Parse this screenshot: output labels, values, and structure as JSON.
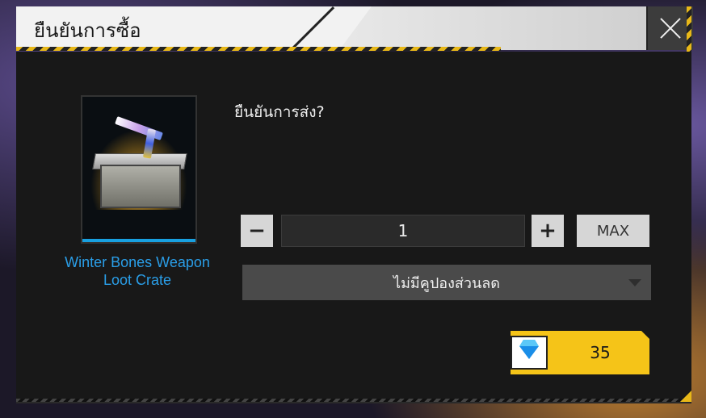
{
  "dialog": {
    "title": "ยืนยันการซื้อ",
    "question": "ยืนยันการส่ง?"
  },
  "item": {
    "name": "Winter Bones Weapon Loot Crate"
  },
  "quantity": {
    "minus_label": "−",
    "value": "1",
    "plus_label": "+",
    "max_label": "MAX"
  },
  "coupon": {
    "selected": "ไม่มีคูปองส่วนลด"
  },
  "purchase": {
    "currency_icon": "diamond-icon",
    "price": "35"
  },
  "colors": {
    "accent_yellow": "#f5c418",
    "item_name_blue": "#2a9ee8",
    "diamond_blue": "#1a8ee8"
  }
}
